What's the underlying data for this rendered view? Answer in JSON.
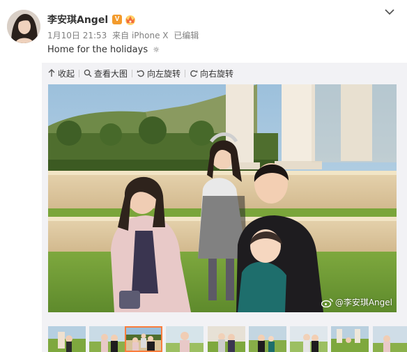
{
  "author": {
    "name": "李安琪Angel",
    "verified_badge": "V"
  },
  "post": {
    "date": "1月10日 21:53",
    "source": "来自 iPhone X",
    "edited": "已编辑",
    "text": "Home for the holidays",
    "text_glyph": "☼"
  },
  "toolbar": {
    "collapse": "收起",
    "view_large": "查看大图",
    "rotate_left": "向左旋转",
    "rotate_right": "向右旋转"
  },
  "photo": {
    "watermark": "@李安琪Angel"
  },
  "thumbnails": {
    "selected_index": 2,
    "count": 9
  },
  "colors": {
    "accent": "#fa7d3c",
    "badge": "#f39b2c",
    "meta_text": "#808080",
    "panel_bg": "#f2f2f5"
  }
}
